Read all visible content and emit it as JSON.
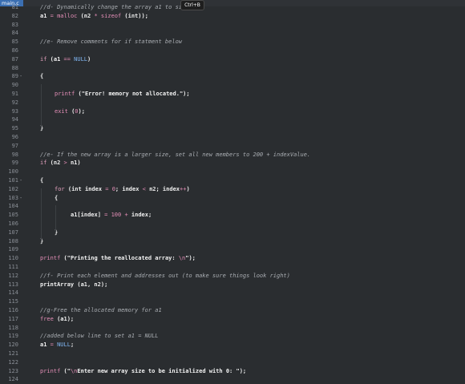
{
  "tab": {
    "label": "main.c"
  },
  "tooltip": {
    "text": "Ctrl+B"
  },
  "lines": [
    {
      "n": "81",
      "fold": "",
      "indent": 1,
      "tokens": [
        [
          "com",
          "//d- Dynamically change the array a1 to size n2"
        ]
      ]
    },
    {
      "n": "82",
      "fold": "",
      "indent": 1,
      "tokens": [
        [
          "id",
          "a1 "
        ],
        [
          "op",
          "="
        ],
        [
          "fn",
          " malloc "
        ],
        [
          "punc",
          "(n2 "
        ],
        [
          "op",
          "*"
        ],
        [
          "fn",
          " sizeof "
        ],
        [
          "punc",
          "("
        ],
        [
          "type",
          "int"
        ],
        [
          "punc",
          "));"
        ]
      ]
    },
    {
      "n": "83",
      "fold": "",
      "indent": 1,
      "tokens": []
    },
    {
      "n": "84",
      "fold": "",
      "indent": 1,
      "tokens": []
    },
    {
      "n": "85",
      "fold": "",
      "indent": 1,
      "tokens": [
        [
          "com",
          "//e- Remove comments for if statment below"
        ]
      ]
    },
    {
      "n": "86",
      "fold": "",
      "indent": 1,
      "tokens": []
    },
    {
      "n": "87",
      "fold": "",
      "indent": 1,
      "tokens": [
        [
          "kw",
          "if"
        ],
        [
          "punc",
          " (a1 "
        ],
        [
          "op",
          "=="
        ],
        [
          "const",
          " NULL"
        ],
        [
          "punc",
          ")"
        ]
      ]
    },
    {
      "n": "88",
      "fold": "",
      "indent": 1,
      "tokens": []
    },
    {
      "n": "89",
      "fold": "-",
      "indent": 1,
      "tokens": [
        [
          "punc",
          "{"
        ]
      ]
    },
    {
      "n": "90",
      "fold": "",
      "indent": 1,
      "tokens": []
    },
    {
      "n": "91",
      "fold": "",
      "indent": 2,
      "tokens": [
        [
          "fn",
          "printf "
        ],
        [
          "punc",
          "("
        ],
        [
          "str",
          "\"Error! memory not allocated.\""
        ],
        [
          "punc",
          ");"
        ]
      ]
    },
    {
      "n": "92",
      "fold": "",
      "indent": 1,
      "tokens": []
    },
    {
      "n": "93",
      "fold": "",
      "indent": 2,
      "tokens": [
        [
          "fn",
          "exit "
        ],
        [
          "punc",
          "("
        ],
        [
          "num",
          "0"
        ],
        [
          "punc",
          ");"
        ]
      ]
    },
    {
      "n": "94",
      "fold": "",
      "indent": 1,
      "tokens": []
    },
    {
      "n": "95",
      "fold": "",
      "indent": 1,
      "tokens": [
        [
          "punc",
          "}"
        ]
      ]
    },
    {
      "n": "96",
      "fold": "",
      "indent": 1,
      "tokens": []
    },
    {
      "n": "97",
      "fold": "",
      "indent": 1,
      "tokens": []
    },
    {
      "n": "98",
      "fold": "",
      "indent": 1,
      "tokens": [
        [
          "com",
          "//e- If the new array is a larger size, set all new members to 200 + indexValue."
        ]
      ]
    },
    {
      "n": "99",
      "fold": "",
      "indent": 1,
      "tokens": [
        [
          "kw",
          "if"
        ],
        [
          "punc",
          " (n2 "
        ],
        [
          "op",
          ">"
        ],
        [
          "punc",
          " n1)"
        ]
      ]
    },
    {
      "n": "100",
      "fold": "",
      "indent": 1,
      "tokens": []
    },
    {
      "n": "101",
      "fold": "-",
      "indent": 1,
      "tokens": [
        [
          "punc",
          "{"
        ]
      ]
    },
    {
      "n": "102",
      "fold": "",
      "indent": 2,
      "tokens": [
        [
          "kw",
          "for"
        ],
        [
          "punc",
          " ("
        ],
        [
          "type",
          "int"
        ],
        [
          "punc",
          " index "
        ],
        [
          "op",
          "="
        ],
        [
          "num",
          " 0"
        ],
        [
          "punc",
          "; index "
        ],
        [
          "op",
          "<"
        ],
        [
          "punc",
          " n2; index"
        ],
        [
          "op",
          "++"
        ],
        [
          "punc",
          ")"
        ]
      ]
    },
    {
      "n": "103",
      "fold": "-",
      "indent": 2,
      "tokens": [
        [
          "punc",
          "{"
        ]
      ]
    },
    {
      "n": "104",
      "fold": "",
      "indent": 2,
      "tokens": []
    },
    {
      "n": "105",
      "fold": "",
      "indent": 3,
      "tokens": [
        [
          "punc",
          "a1[index] "
        ],
        [
          "op",
          "="
        ],
        [
          "num",
          " 100 "
        ],
        [
          "op",
          "+"
        ],
        [
          "punc",
          " index;"
        ]
      ]
    },
    {
      "n": "106",
      "fold": "",
      "indent": 2,
      "tokens": []
    },
    {
      "n": "107",
      "fold": "",
      "indent": 2,
      "tokens": [
        [
          "punc",
          "}"
        ]
      ]
    },
    {
      "n": "108",
      "fold": "",
      "indent": 1,
      "tokens": [
        [
          "punc",
          "}"
        ]
      ]
    },
    {
      "n": "109",
      "fold": "",
      "indent": 1,
      "tokens": []
    },
    {
      "n": "110",
      "fold": "",
      "indent": 1,
      "tokens": [
        [
          "fn",
          "printf "
        ],
        [
          "punc",
          "("
        ],
        [
          "str",
          "\"Printing the reallocated array: "
        ],
        [
          "esc",
          "\\n"
        ],
        [
          "str",
          "\""
        ],
        [
          "punc",
          ");"
        ]
      ]
    },
    {
      "n": "111",
      "fold": "",
      "indent": 1,
      "tokens": []
    },
    {
      "n": "112",
      "fold": "",
      "indent": 1,
      "tokens": [
        [
          "com",
          "//f- Print each element and addresses out (to make sure things look right)"
        ]
      ]
    },
    {
      "n": "113",
      "fold": "",
      "indent": 1,
      "tokens": [
        [
          "id",
          "printArray (a1, n2);"
        ]
      ]
    },
    {
      "n": "114",
      "fold": "",
      "indent": 1,
      "tokens": []
    },
    {
      "n": "115",
      "fold": "",
      "indent": 1,
      "tokens": []
    },
    {
      "n": "116",
      "fold": "",
      "indent": 1,
      "tokens": [
        [
          "com",
          "//g-Free the allocated memory for a1"
        ]
      ]
    },
    {
      "n": "117",
      "fold": "",
      "indent": 1,
      "tokens": [
        [
          "fn",
          "free "
        ],
        [
          "punc",
          "(a1);"
        ]
      ]
    },
    {
      "n": "118",
      "fold": "",
      "indent": 1,
      "tokens": []
    },
    {
      "n": "119",
      "fold": "",
      "indent": 1,
      "tokens": [
        [
          "com",
          "//added below line to set a1 = NULL"
        ]
      ]
    },
    {
      "n": "120",
      "fold": "",
      "indent": 1,
      "tokens": [
        [
          "id",
          "a1 "
        ],
        [
          "op",
          "="
        ],
        [
          "const",
          " NULL"
        ],
        [
          "punc",
          ";"
        ]
      ]
    },
    {
      "n": "121",
      "fold": "",
      "indent": 1,
      "tokens": []
    },
    {
      "n": "122",
      "fold": "",
      "indent": 1,
      "tokens": []
    },
    {
      "n": "123",
      "fold": "",
      "indent": 1,
      "tokens": [
        [
          "fn",
          "printf "
        ],
        [
          "punc",
          "("
        ],
        [
          "str",
          "\""
        ],
        [
          "esc",
          "\\n"
        ],
        [
          "str",
          "Enter new array size to be initialized with 0: \""
        ],
        [
          "punc",
          ");"
        ]
      ]
    },
    {
      "n": "124",
      "fold": "",
      "indent": 1,
      "tokens": []
    }
  ]
}
